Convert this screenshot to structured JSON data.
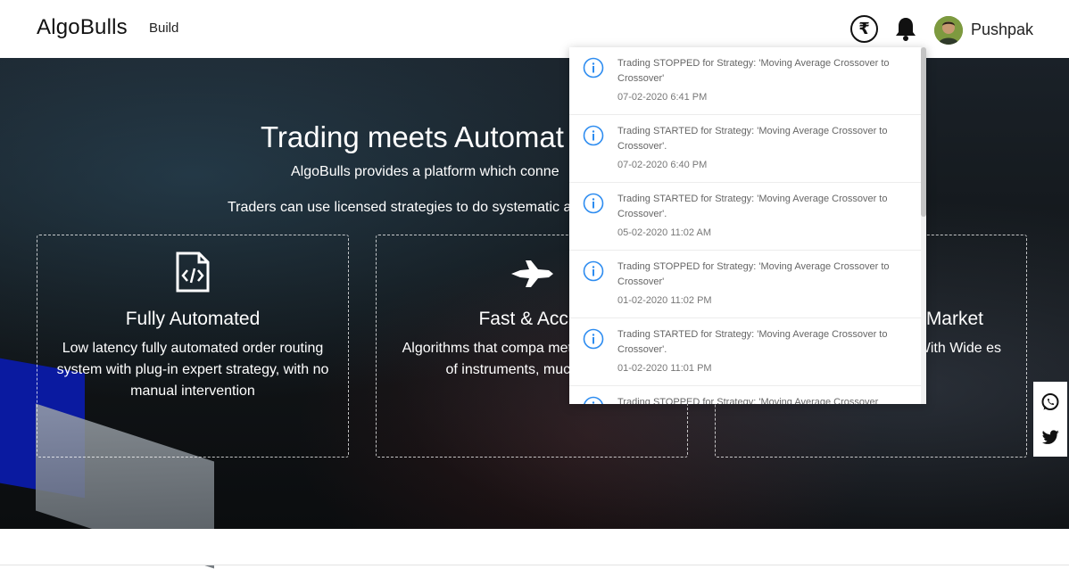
{
  "header": {
    "logo": "AlgoBulls",
    "nav_build": "Build",
    "currency_symbol": "₹",
    "username": "Pushpak"
  },
  "hero": {
    "title": "Trading meets Automat",
    "subtitle1": "AlgoBulls provides a platform which conne",
    "subtitle2": "Traders can use licensed strategies to do systematic a"
  },
  "cards": [
    {
      "icon": "code-file-icon",
      "title": "Fully Automated",
      "desc": "Low latency fully automated order routing system with plug-in expert strategy, with no manual intervention"
    },
    {
      "icon": "jet-icon",
      "title": "Fast & Accur",
      "desc": "Algorithms that compa metrics of millions of instruments, much faster"
    },
    {
      "icon": "",
      "title": "Market",
      "desc": "With Wide es"
    }
  ],
  "notifications": [
    {
      "message": "Trading STOPPED for Strategy: 'Moving Average Crossover to Crossover'",
      "time": "07-02-2020 6:41 PM"
    },
    {
      "message": "Trading STARTED for Strategy: 'Moving Average Crossover to Crossover'.",
      "time": "07-02-2020 6:40 PM"
    },
    {
      "message": "Trading STARTED for Strategy: 'Moving Average Crossover to Crossover'.",
      "time": "05-02-2020 11:02 AM"
    },
    {
      "message": "Trading STOPPED for Strategy: 'Moving Average Crossover to Crossover'",
      "time": "01-02-2020 11:02 PM"
    },
    {
      "message": "Trading STARTED for Strategy: 'Moving Average Crossover to Crossover'.",
      "time": "01-02-2020 11:01 PM"
    },
    {
      "message": "Trading STOPPED for Strategy: 'Moving Average Crossover",
      "time": ""
    }
  ],
  "social": [
    "whatsapp-icon",
    "twitter-icon"
  ],
  "colors": {
    "info_icon": "#2d8cf0",
    "hero_text": "#ffffff"
  }
}
